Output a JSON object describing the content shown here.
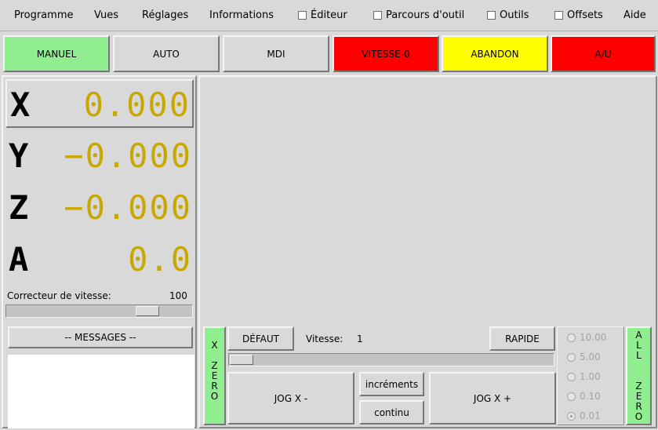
{
  "menu": {
    "items": [
      "Programme",
      "Vues",
      "Réglages",
      "Informations"
    ],
    "checks": [
      {
        "label": "Éditeur",
        "checked": false
      },
      {
        "label": "Parcours d'outil",
        "checked": false
      },
      {
        "label": "Outils",
        "checked": false
      },
      {
        "label": "Offsets",
        "checked": false
      }
    ],
    "help": "Aide"
  },
  "modes": [
    {
      "label": "MANUEL",
      "color": "#90ee90"
    },
    {
      "label": "AUTO",
      "color": "#d9d9d9"
    },
    {
      "label": "MDI",
      "color": "#d9d9d9"
    },
    {
      "label": "VITESSE-0",
      "color": "#ff0000"
    },
    {
      "label": "ABANDON",
      "color": "#ffff00"
    },
    {
      "label": "A/U",
      "color": "#ff0000"
    }
  ],
  "dro": [
    {
      "axis": "X",
      "value": "0.000",
      "selected": true
    },
    {
      "axis": "Y",
      "value": "−0.000",
      "selected": false
    },
    {
      "axis": "Z",
      "value": "−0.000",
      "selected": false
    },
    {
      "axis": "A",
      "value": "0.0",
      "selected": false
    }
  ],
  "dro_color": "#c8a800",
  "feed_override": {
    "label": "Correcteur de vitesse:",
    "value": "100",
    "fraction": 0.8
  },
  "messages_button": "-- MESSAGES --",
  "jog": {
    "zero_letters": [
      "X",
      "Z",
      "E",
      "R",
      "O"
    ],
    "default_button": "DÉFAUT",
    "speed_label": "Vitesse:",
    "speed_value": "1",
    "rapid_button": "RAPIDE",
    "speed_fraction": 0.0,
    "jog_minus": "JOG X -",
    "jog_plus": "JOG X +",
    "increments": "incréments",
    "continuous": "continu",
    "increments_options": [
      {
        "label": "10.00",
        "selected": false
      },
      {
        "label": "5.00",
        "selected": false
      },
      {
        "label": "1.00",
        "selected": false
      },
      {
        "label": "0.10",
        "selected": false
      },
      {
        "label": "0.01",
        "selected": true
      }
    ],
    "all_zero_letters": [
      "A",
      "L",
      "L",
      "",
      "Z",
      "E",
      "R",
      "O"
    ],
    "zero_color": "#90ee90"
  }
}
